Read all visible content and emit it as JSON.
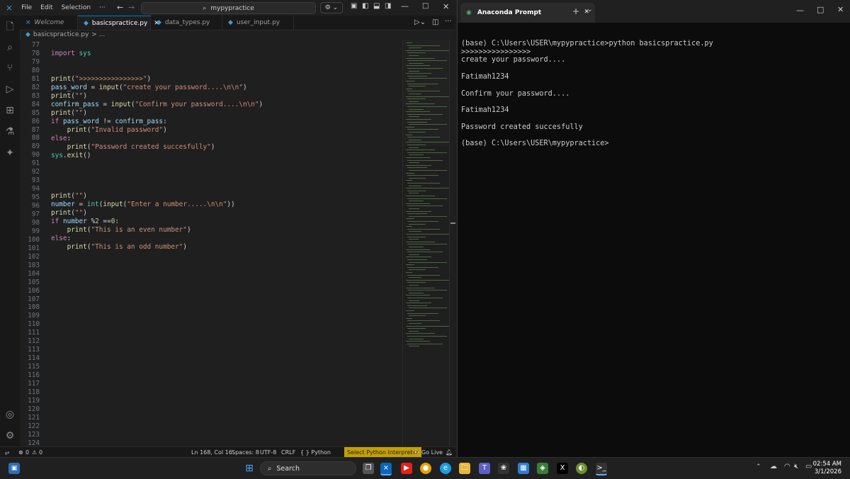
{
  "vscode": {
    "menu": [
      "File",
      "Edit",
      "Selection"
    ],
    "search": "mypypractice",
    "tabs": [
      {
        "label": "Welcome",
        "active": false
      },
      {
        "label": "basicspractice.py",
        "active": true
      },
      {
        "label": "data_types.py",
        "active": false
      },
      {
        "label": "user_input.py",
        "active": false
      }
    ],
    "breadcrumb": "basicspractice.py",
    "breadcrumb_tail": ">  ...",
    "line_numbers": [
      "77",
      "78",
      "79",
      "80",
      "81",
      "82",
      "83",
      "84",
      "85",
      "86",
      "87",
      "88",
      "89",
      "90",
      "91",
      "92",
      "93",
      "94",
      "95",
      "96",
      "97",
      "98",
      "99",
      "100",
      "101",
      "102",
      "103",
      "104",
      "105",
      "106",
      "107",
      "108",
      "109",
      "110",
      "111",
      "112",
      "113",
      "114",
      "115",
      "116",
      "117",
      "118",
      "119",
      "120",
      "121",
      "122",
      "123",
      "124"
    ],
    "code": {
      "l78": "import sys",
      "l81": "print(\">>>>>>>>>>>>>>>>\")",
      "l82": "pass_word = input(\"create your password....\\n\\n\")",
      "l83": "print(\"\")",
      "l84": "confirm_pass = input(\"Confirm your password....\\n\\n\")",
      "l85": "print(\"\")",
      "l86": "if pass_word != confirm_pass:",
      "l87": "    print(\"Invalid password\")",
      "l88": "else:",
      "l89": "    print(\"Password created succesfully\")",
      "l90": "sys.exit()",
      "l94": "print(\"\")",
      "l95": "number = int(input(\"Enter a number.....\\n\\n\"))",
      "l96": "print(\"\")",
      "l97": "if number %2 ==0:",
      "l98": "    print(\"This is an even number\")",
      "l99": "else:",
      "l100": "    print(\"This is an odd number\")"
    },
    "status": {
      "errors": "0",
      "warnings": "0",
      "position": "Ln 168, Col 16",
      "spaces": "Spaces: 8",
      "encoding": "UTF-8",
      "eol": "CRLF",
      "language": "{ } Python",
      "interpreter": "Select Python Interpreter",
      "golive": "Go Live"
    }
  },
  "prompt": {
    "title": "Anaconda Prompt",
    "lines": [
      "",
      "(base) C:\\Users\\USER\\mypypractice>python basicspractice.py",
      ">>>>>>>>>>>>>>>>",
      "create your password....",
      "",
      "Fatimah1234",
      "",
      "Confirm your password....",
      "",
      "Fatimah1234",
      "",
      "Password created succesfully",
      "",
      "(base) C:\\Users\\USER\\mypypractice>"
    ]
  },
  "taskbar": {
    "search_label": "Search",
    "time": "02:54 AM",
    "date": "3/1/2026"
  }
}
